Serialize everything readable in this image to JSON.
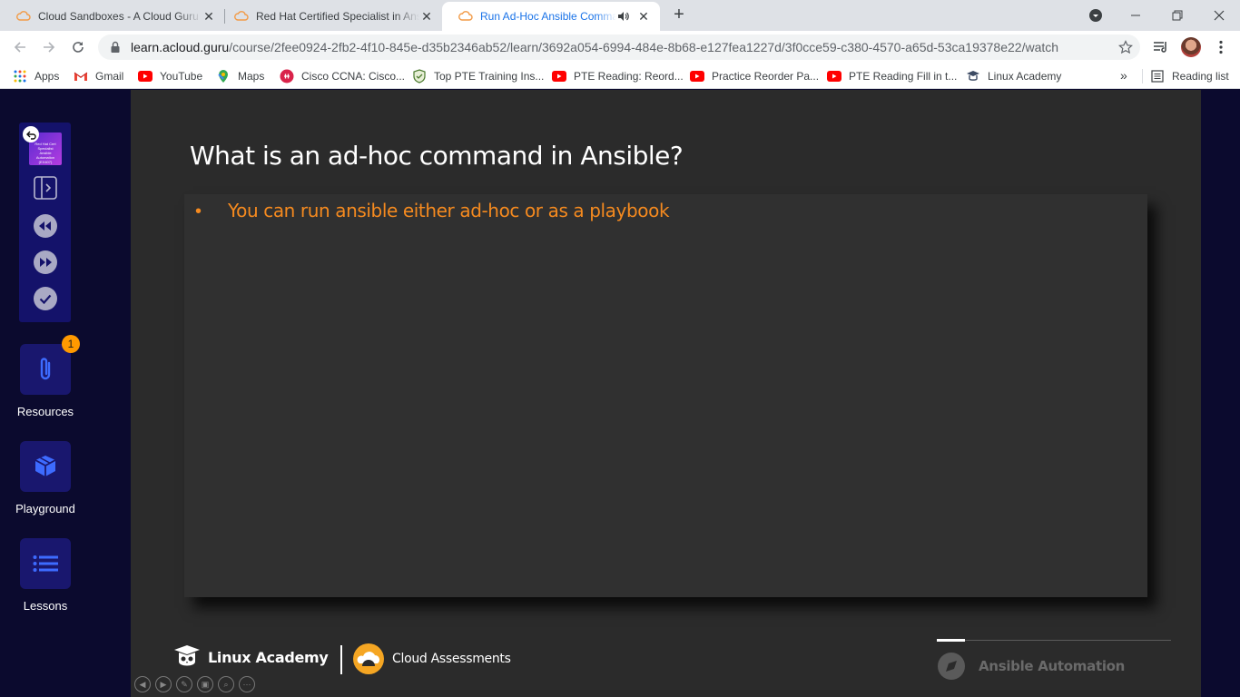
{
  "browser": {
    "tabs": [
      {
        "title": "Cloud Sandboxes - A Cloud Guru",
        "active": false
      },
      {
        "title": "Red Hat Certified Specialist in Ansible",
        "active": false
      },
      {
        "title": "Run Ad-Hoc Ansible Commands",
        "active": true
      }
    ],
    "new_tab_label": "+",
    "url_host": "learn.acloud.guru",
    "url_path": "/course/2fee0924-2fb2-4f10-845e-d35b2346ab52/learn/3692a054-6994-484e-8b68-e127fea1227d/3f0cce59-c380-4570-a65d-53ca19378e22/watch",
    "bookmarks": [
      {
        "label": "Apps",
        "icon": "apps-grid-icon"
      },
      {
        "label": "Gmail",
        "icon": "gmail-icon"
      },
      {
        "label": "YouTube",
        "icon": "youtube-icon"
      },
      {
        "label": "Maps",
        "icon": "maps-icon"
      },
      {
        "label": "Cisco CCNA: Cisco...",
        "icon": "cisco-icon"
      },
      {
        "label": "Top PTE Training Ins...",
        "icon": "shield-logo-icon"
      },
      {
        "label": "PTE Reading: Reord...",
        "icon": "youtube-icon"
      },
      {
        "label": "Practice Reorder Pa...",
        "icon": "youtube-icon"
      },
      {
        "label": "PTE Reading Fill in t...",
        "icon": "youtube-icon"
      },
      {
        "label": "Linux Academy",
        "icon": "linux-academy-icon"
      }
    ],
    "more_bookmarks": "»",
    "reading_list": "Reading list"
  },
  "sidebar": {
    "course_thumb_text": "Red Hat Cert Specialist Ansible Automation (EX407)",
    "resources": {
      "label": "Resources",
      "badge": "1"
    },
    "playground": {
      "label": "Playground"
    },
    "lessons": {
      "label": "Lessons"
    }
  },
  "slide": {
    "title": "What is an ad-hoc command in Ansible?",
    "bullets": [
      "You can run ansible either ad-hoc or as a playbook"
    ],
    "bullet_symbol": "•"
  },
  "footer": {
    "brand": "Linux Academy",
    "partner": "Cloud Assessments",
    "course": "Ansible Automation",
    "progress": 0.12
  },
  "colors": {
    "accent_orange": "#f58a1f",
    "sidebar_bg": "#0b0a2e",
    "tile_bg": "#19176e",
    "icon_blue": "#3d6bff",
    "badge": "#ff9900"
  }
}
